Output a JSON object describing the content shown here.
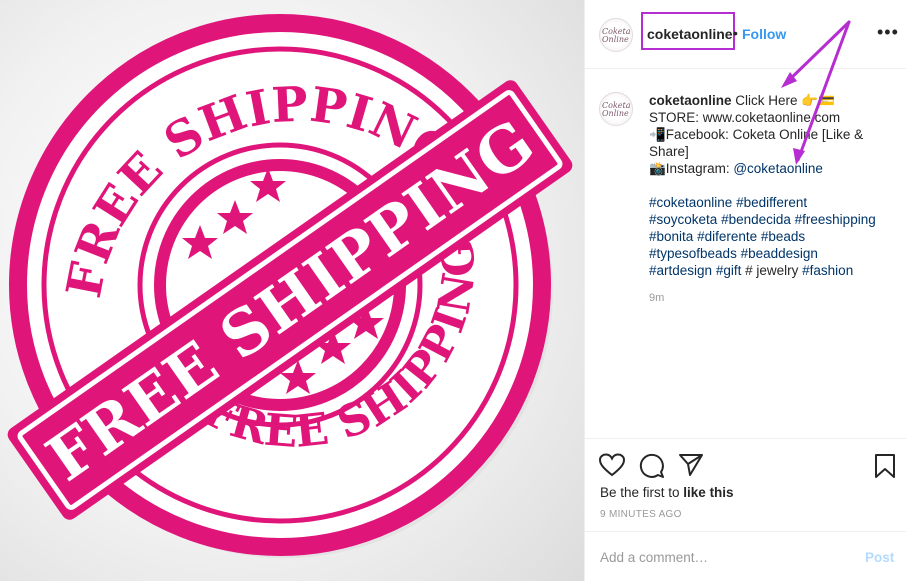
{
  "image": {
    "stamp_outer_text_top": "FREE SHIPPING",
    "stamp_outer_text_bottom": "FREE SHIPPING",
    "banner_text": "FREE SHIPPING",
    "colors": {
      "stamp": "#e0157a",
      "background": "#f0f0f0"
    }
  },
  "header": {
    "avatar_text": "Coketa Online",
    "username": "coketaonline",
    "separator": "•",
    "follow_label": "Follow",
    "more_icon": "more-horizontal-icon"
  },
  "caption": {
    "username": "coketaonline",
    "line1": "Click Here 👉💳",
    "line2": "STORE: www.coketaonline.com",
    "line3": "📲Facebook: Coketa Online [Like & Share]",
    "line4_prefix": "📸Instagram: ",
    "line4_mention": "@coketaonline",
    "hashtags_row1": [
      "#coketaonline",
      "#bedifferent"
    ],
    "hashtags_row2": [
      "#soycoketa",
      "#bendecida",
      "#freeshipping"
    ],
    "hashtags_row3": [
      "#bonita",
      "#diferente",
      "#beads"
    ],
    "hashtags_row4": [
      "#typesofbeads",
      "#beaddesign"
    ],
    "hashtags_row5_a": "#artdesign",
    "hashtags_row5_b": "#gift",
    "hashtags_row5_plain": "# jewelry",
    "hashtags_row5_c": "#fashion",
    "time_ago": "9m"
  },
  "actions": {
    "icons": [
      "heart-icon",
      "comment-icon",
      "share-icon",
      "bookmark-icon"
    ],
    "likes_prefix": "Be the first to ",
    "likes_link": "like this",
    "post_date": "9 MINUTES AGO"
  },
  "comment": {
    "placeholder": "Add a comment…",
    "post_label": "Post"
  },
  "annotations": {
    "highlight_color": "#b62ed1"
  }
}
